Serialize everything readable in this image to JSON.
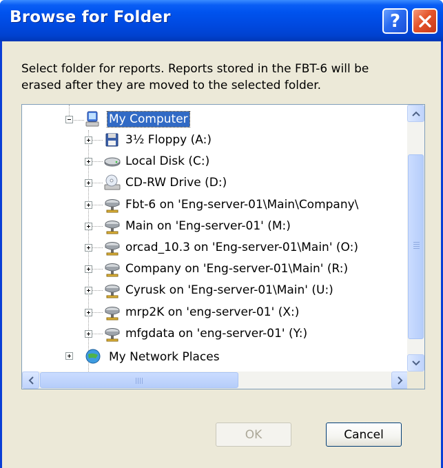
{
  "window": {
    "title": "Browse for Folder"
  },
  "titlebar": {
    "help_glyph": "?",
    "help_icon": "help-icon",
    "close_icon": "close-icon"
  },
  "prompt": "Select folder for reports. Reports stored in the FBT-6 will be\nerased after they are moved to the selected folder.",
  "tree": {
    "root": {
      "label": "My Computer",
      "icon": "computer-icon",
      "selected": true
    },
    "items": [
      {
        "label": "3½ Floppy (A:)",
        "icon": "floppy-icon"
      },
      {
        "label": "Local Disk (C:)",
        "icon": "hard-disk-icon"
      },
      {
        "label": "CD-RW Drive (D:)",
        "icon": "cd-drive-icon"
      },
      {
        "label": "Fbt-6 on 'Eng-server-01\\Main\\Company\\",
        "icon": "network-drive-icon"
      },
      {
        "label": "Main on 'Eng-server-01' (M:)",
        "icon": "network-drive-icon"
      },
      {
        "label": "orcad_10.3 on 'Eng-server-01\\Main' (O:)",
        "icon": "network-drive-icon"
      },
      {
        "label": "Company on 'Eng-server-01\\Main' (R:)",
        "icon": "network-drive-icon"
      },
      {
        "label": "Cyrusk on 'Eng-server-01\\Main' (U:)",
        "icon": "network-drive-icon"
      },
      {
        "label": "mrp2K on 'eng-server-01' (X:)",
        "icon": "network-drive-icon"
      },
      {
        "label": "mfgdata on 'eng-server-01' (Y:)",
        "icon": "network-drive-icon"
      }
    ],
    "next": {
      "label": "My Network Places",
      "icon": "network-places-icon"
    }
  },
  "buttons": {
    "ok": "OK",
    "cancel": "Cancel",
    "ok_enabled": false
  },
  "colors": {
    "title_bar": "#0053ee",
    "selection": "#316ac5",
    "dialog_bg": "#ece9d8",
    "close_red": "#e4542a"
  }
}
